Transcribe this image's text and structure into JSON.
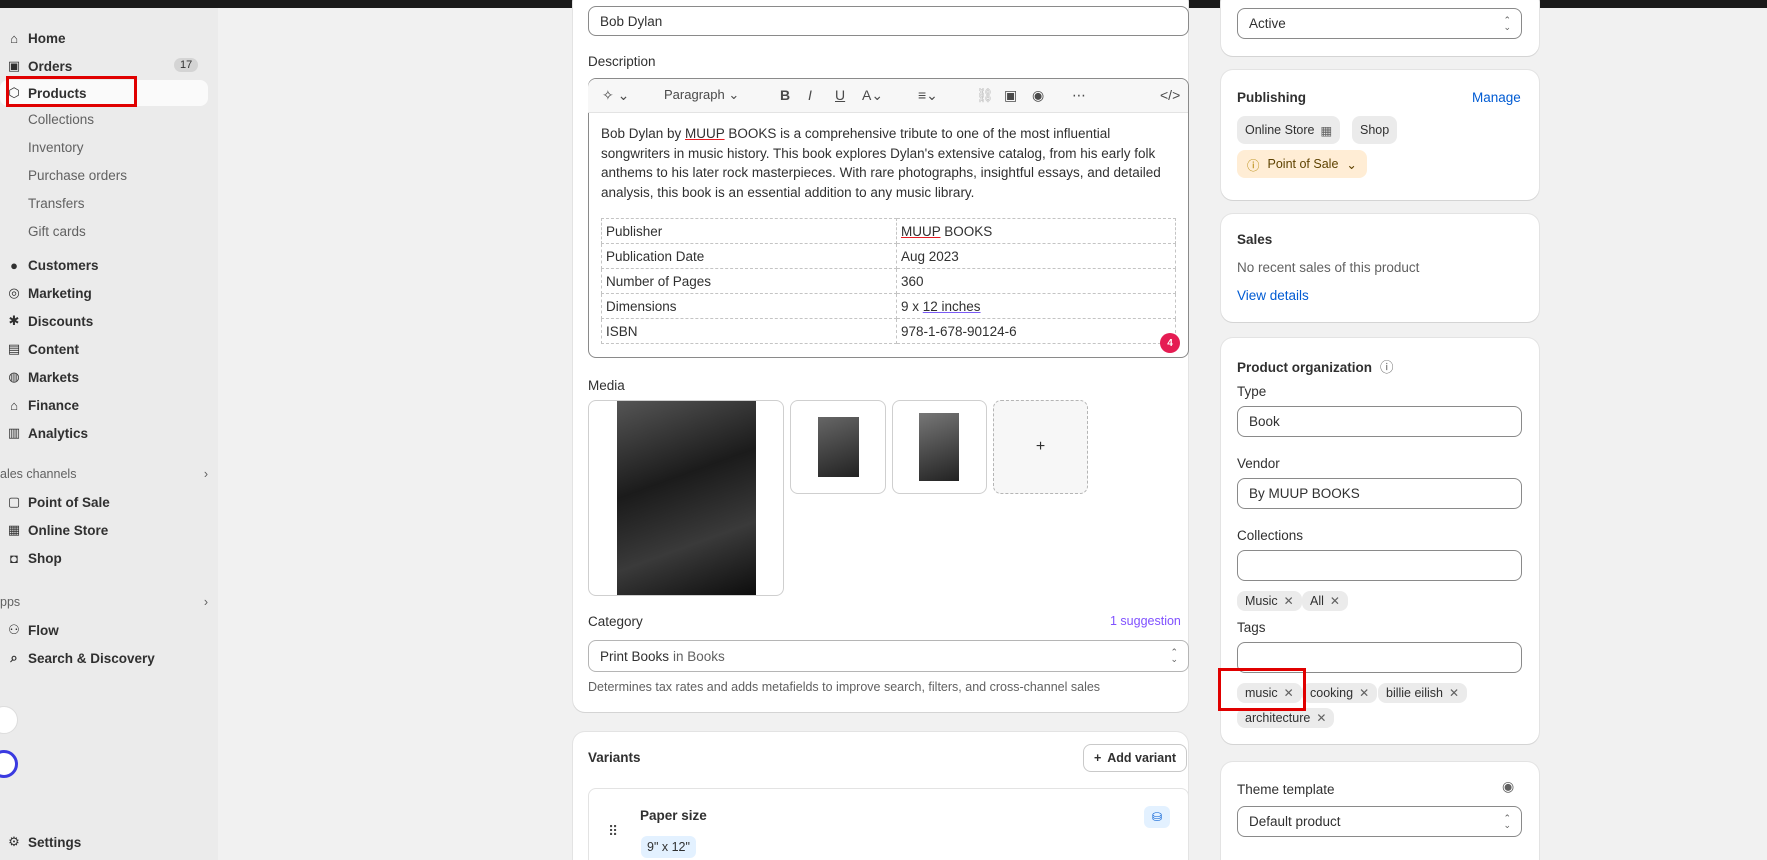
{
  "sidebar": {
    "items": [
      {
        "label": "Home",
        "icon": "home-icon"
      },
      {
        "label": "Orders",
        "icon": "inbox-icon",
        "badge": "17"
      },
      {
        "label": "Products",
        "icon": "tag-icon"
      }
    ],
    "product_subitems": [
      "Collections",
      "Inventory",
      "Purchase orders",
      "Transfers",
      "Gift cards"
    ],
    "items2": [
      {
        "label": "Customers",
        "icon": "person-icon"
      },
      {
        "label": "Marketing",
        "icon": "target-icon"
      },
      {
        "label": "Discounts",
        "icon": "discount-icon"
      },
      {
        "label": "Content",
        "icon": "content-icon"
      },
      {
        "label": "Markets",
        "icon": "globe-icon"
      },
      {
        "label": "Finance",
        "icon": "bank-icon"
      },
      {
        "label": "Analytics",
        "icon": "chart-icon"
      }
    ],
    "sales_channels_label": "ales channels",
    "channels": [
      "Point of Sale",
      "Online Store",
      "Shop"
    ],
    "apps_label": "pps",
    "apps": [
      "Flow",
      "Search & Discovery"
    ],
    "settings": "Settings"
  },
  "product": {
    "title_value": "Bob Dylan",
    "description_label": "Description",
    "toolbar_paragraph": "Paragraph",
    "description_text_pre": "Bob Dylan by ",
    "description_text_spell": "MUUP",
    "description_text_post": " BOOKS is a comprehensive tribute to one of the most influential songwriters in music history. This book explores Dylan's extensive catalog, from his early folk anthems to his later rock masterpieces. With rare photographs, insightful essays, and detailed analysis, this book is an essential addition to any music library.",
    "specs": [
      {
        "k": "Publisher",
        "v_spell": "MUUP",
        "v_rest": " BOOKS"
      },
      {
        "k": "Publication Date",
        "v": "Aug 2023"
      },
      {
        "k": "Number of Pages",
        "v": "360"
      },
      {
        "k": "Dimensions",
        "v_d1": "9 x ",
        "v_d2": "12 inches"
      },
      {
        "k": "ISBN",
        "v": "978-1-678-90124-6"
      }
    ],
    "error_count": "4",
    "media_label": "Media",
    "media_add": "+",
    "category_label": "Category",
    "category_suggestion": "1 suggestion",
    "category_value": "Print Books",
    "category_in": " in Books",
    "category_help": "Determines tax rates and adds metafields to improve search, filters, and cross-channel sales",
    "variants_label": "Variants",
    "add_variant": "Add variant",
    "variant_option": "Paper size",
    "variant_value": "9\" x 12\""
  },
  "status": {
    "value": "Active"
  },
  "publishing": {
    "title": "Publishing",
    "manage": "Manage",
    "channels": [
      "Online Store",
      "Shop"
    ],
    "pos": "Point of Sale"
  },
  "sales": {
    "title": "Sales",
    "text": "No recent sales of this product",
    "link": "View details"
  },
  "organization": {
    "title": "Product organization",
    "type_label": "Type",
    "type_value": "Book",
    "vendor_label": "Vendor",
    "vendor_value": "By MUUP BOOKS",
    "collections_label": "Collections",
    "collections": [
      "Music",
      "All"
    ],
    "tags_label": "Tags",
    "tags": [
      "music",
      "cooking",
      "billie eilish",
      "architecture"
    ]
  },
  "theme": {
    "title": "Theme template",
    "value": "Default product"
  },
  "colors": {
    "accent": "#005bd3",
    "highlight": "#e00000",
    "suggestion": "#8051ff",
    "error": "#e51c53"
  }
}
